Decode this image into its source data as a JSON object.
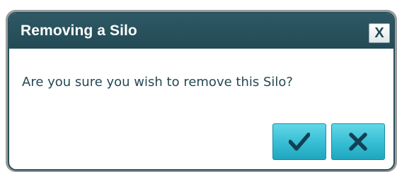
{
  "dialog": {
    "title": "Removing a Silo",
    "message": "Are you sure you wish to remove this Silo?",
    "close_label": "X"
  },
  "buttons": {
    "confirm_icon": "checkmark-icon",
    "cancel_icon": "x-icon"
  },
  "colors": {
    "titlebar": "#27505b",
    "button_accent": "#35bdd3",
    "text": "#254952"
  }
}
